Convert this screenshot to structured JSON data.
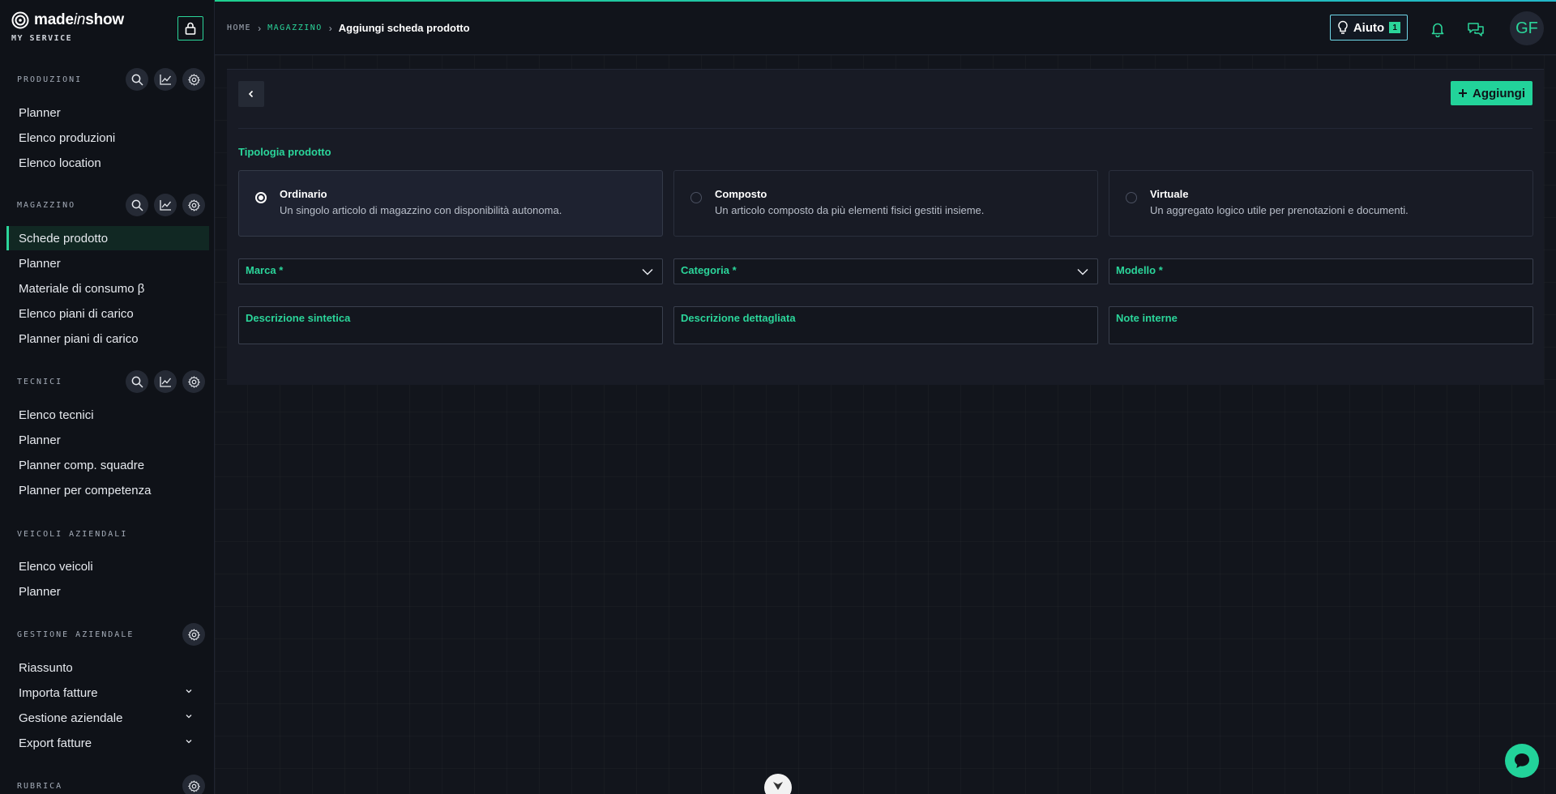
{
  "brand": {
    "name_prefix": "made",
    "name_italic": "in",
    "name_suffix": "show",
    "subtitle": "MY SERVICE"
  },
  "sidebar": {
    "sections": [
      {
        "title": "PRODUZIONI",
        "items": [
          "Planner",
          "Elenco produzioni",
          "Elenco location"
        ]
      },
      {
        "title": "MAGAZZINO",
        "items": [
          "Schede prodotto",
          "Planner",
          "Materiale di consumo β",
          "Elenco piani di carico",
          "Planner piani di carico"
        ]
      },
      {
        "title": "TECNICI",
        "items": [
          "Elenco tecnici",
          "Planner",
          "Planner comp. squadre",
          "Planner per competenza"
        ]
      },
      {
        "title": "VEICOLI AZIENDALI",
        "items": [
          "Elenco veicoli",
          "Planner"
        ]
      },
      {
        "title": "GESTIONE AZIENDALE",
        "items": [
          "Riassunto",
          "Importa fatture",
          "Gestione aziendale",
          "Export fatture"
        ]
      },
      {
        "title": "RUBRICA",
        "items": []
      }
    ],
    "active_item": "Schede prodotto"
  },
  "breadcrumb": {
    "home": "HOME",
    "section": "MAGAZZINO",
    "current": "Aggiungi scheda prodotto"
  },
  "header": {
    "help_label": "Aiuto",
    "help_badge": "1",
    "avatar_initials": "GF"
  },
  "page": {
    "add_label": "Aggiungi",
    "type_section_label": "Tipologia prodotto",
    "types": [
      {
        "title": "Ordinario",
        "desc": "Un singolo articolo di magazzino con disponibilità autonoma.",
        "selected": true
      },
      {
        "title": "Composto",
        "desc": "Un articolo composto da più elementi fisici gestiti insieme.",
        "selected": false
      },
      {
        "title": "Virtuale",
        "desc": "Un aggregato logico utile per prenotazioni e documenti.",
        "selected": false
      }
    ],
    "fields": {
      "marca": "Marca *",
      "categoria": "Categoria *",
      "modello": "Modello *",
      "desc_sintetica": "Descrizione sintetica",
      "desc_dettagliata": "Descrizione dettagliata",
      "note_interne": "Note interne"
    }
  },
  "colors": {
    "accent": "#2bd59a",
    "background": "#11141b",
    "sidebar": "#0f1218",
    "card": "#181b25"
  }
}
